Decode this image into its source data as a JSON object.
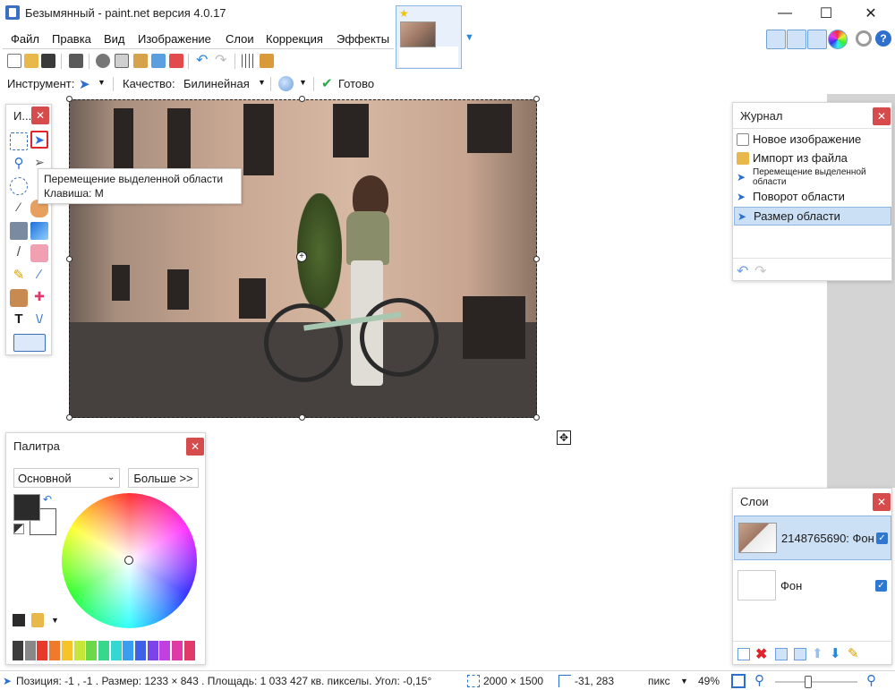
{
  "window": {
    "title": "Безымянный - paint.net версия 4.0.17",
    "minimize": "—",
    "maximize": "☐",
    "close": "✕"
  },
  "menu": [
    "Файл",
    "Правка",
    "Вид",
    "Изображение",
    "Слои",
    "Коррекция",
    "Эффекты"
  ],
  "tool_options": {
    "tool_label": "Инструмент:",
    "quality_label": "Качество:",
    "quality_value": "Билинейная",
    "done_label": "Готово"
  },
  "tools_panel": {
    "title": "И...",
    "close": "✕",
    "tooltip_line1": "Перемещение выделенной области",
    "tooltip_line2": "Клавиша: M"
  },
  "history_panel": {
    "title": "Журнал",
    "close": "✕",
    "items": [
      "Новое изображение",
      "Импорт из файла",
      "Перемещение выделенной области",
      "Поворот области",
      "Размер области"
    ],
    "selected_index": 4
  },
  "palette_panel": {
    "title": "Палитра",
    "close": "✕",
    "mode": "Основной",
    "more_button": "Больше >>",
    "primary_color": "#2b2b2b",
    "secondary_color": "#ffffff",
    "swatches": [
      "#3c3c3c",
      "#888888",
      "#e63a2e",
      "#f07a2a",
      "#f5c428",
      "#c8e63a",
      "#6ad848",
      "#38d88c",
      "#34d8d0",
      "#3a9ef0",
      "#4060e8",
      "#7a44e8",
      "#c040e0",
      "#e03aa8",
      "#e03a6a"
    ]
  },
  "layers_panel": {
    "title": "Слои",
    "close": "✕",
    "layers": [
      {
        "name": "2148765690: Фон",
        "checked": true
      },
      {
        "name": "Фон",
        "checked": true
      }
    ]
  },
  "statusbar": {
    "position_info": "Позиция: -1 , -1 . Размер: 1233 × 843 . Площадь: 1 033 427 кв. пикселы. Угол: -0,15°",
    "image_size": "2000 × 1500",
    "cursor_pos": "-31, 283",
    "units": "пикс",
    "zoom": "49%"
  }
}
